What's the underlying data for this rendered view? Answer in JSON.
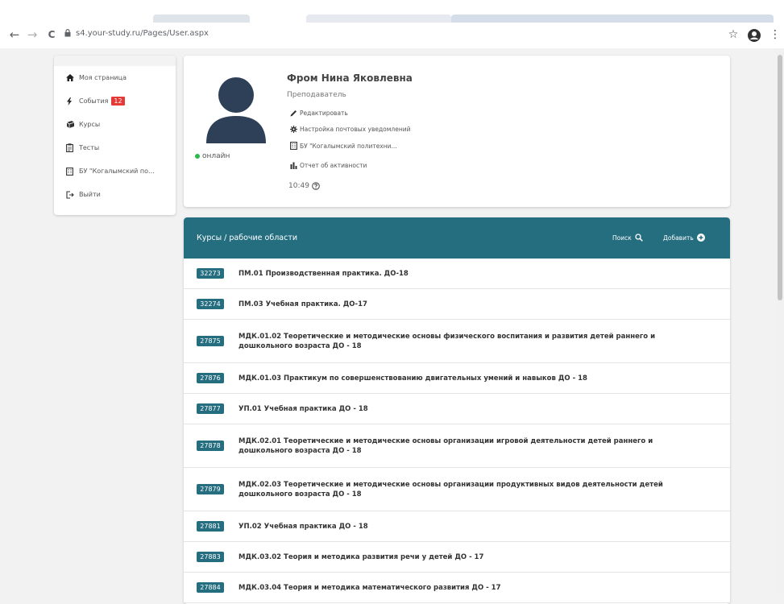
{
  "browser": {
    "url": "s4.your-study.ru/Pages/User.aspx",
    "back_icon": "←",
    "forward_icon": "→",
    "reload_icon": "C",
    "star_icon": "☆",
    "menu_icon": "⋮"
  },
  "sidebar": {
    "items": [
      {
        "label": "Моя страница",
        "icon": "home-icon"
      },
      {
        "label": "События",
        "icon": "bolt-icon",
        "badge": "12"
      },
      {
        "label": "Курсы",
        "icon": "book-icon"
      },
      {
        "label": "Тесты",
        "icon": "clipboard-icon"
      },
      {
        "label": "БУ \"Когалымский по...",
        "icon": "building-icon"
      },
      {
        "label": "Выйти",
        "icon": "logout-icon"
      }
    ]
  },
  "profile": {
    "name": "Фром Нина Яковлевна",
    "role": "Преподаватель",
    "status": "онлайн",
    "status_color": "#2db84a",
    "actions": [
      {
        "label": "Редактировать",
        "icon": "pencil-icon"
      },
      {
        "label": "Настройка почтовых уведомлений",
        "icon": "gear-icon"
      },
      {
        "label": "БУ \"Когалымский политехни...",
        "icon": "building-icon"
      },
      {
        "label": "Отчет об активности",
        "icon": "bar-chart-icon"
      }
    ],
    "time": "10:49"
  },
  "courses": {
    "title": "Курсы / рабочие области",
    "search_label": "Поиск",
    "add_label": "Добавить",
    "accent_color": "#256e80",
    "items": [
      {
        "code": "32273",
        "name": "ПМ.01 Производственная практика. ДО-18"
      },
      {
        "code": "32274",
        "name": "ПМ.03 Учебная практика. ДО-17"
      },
      {
        "code": "27875",
        "name": "МДК.01.02 Теоретические и методические основы физического воспитания и развития детей раннего и дошкольного возраста ДО - 18"
      },
      {
        "code": "27876",
        "name": "МДК.01.03 Практикум по совершенствованию двигательных умений и навыков ДО - 18"
      },
      {
        "code": "27877",
        "name": "УП.01 Учебная практика ДО - 18"
      },
      {
        "code": "27878",
        "name": "МДК.02.01 Теоретические и методические основы организации игровой деятельности детей раннего и дошкольного возраста ДО - 18"
      },
      {
        "code": "27879",
        "name": "МДК.02.03 Теоретические и методические основы организации продуктивных видов деятельности детей дошкольного возраста ДО - 18"
      },
      {
        "code": "27881",
        "name": "УП.02 Учебная практика ДО - 18"
      },
      {
        "code": "27883",
        "name": "МДК.03.02 Теория и методика развития речи у детей ДО - 17"
      },
      {
        "code": "27884",
        "name": "МДК.03.04 Теория и методика математического развития ДО - 17"
      }
    ]
  }
}
